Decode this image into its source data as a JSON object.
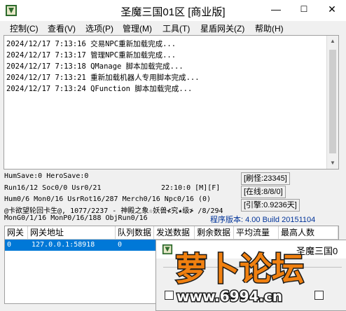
{
  "window": {
    "title": "圣魔三国01区 [商业版]",
    "minimize": "—",
    "maximize": "☐",
    "close": "✕"
  },
  "menu": [
    "控制(C)",
    "查看(V)",
    "选项(P)",
    "管理(M)",
    "工具(T)",
    "星盾网关(Z)",
    "帮助(H)"
  ],
  "log": [
    "2024/12/17 7:13:16 交易NPC重新加载完成...",
    "2024/12/17 7:13:17 管理NPC重新加载完成...",
    "2024/12/17 7:13:18 QManage 脚本加载完成...",
    "2024/12/17 7:13:21 重新加载机器人专用脚本完成...",
    "2024/12/17 7:13:24 QFunction 脚本加载完成..."
  ],
  "status": {
    "line1": "HumSave:0 HeroSave:0",
    "line2": "Run16/12 Soc0/0 Usr0/21",
    "time": "22:10:0 [M][F]",
    "line3": "Hum0/6 Mon0/16 UsrRot16/287 Merch0/16 Npc0/16 (0)",
    "line4": "@卡欲望轮回卡生@, 1077/2237 - 神殿之象☆妖兽≮究★级≯ /8/294",
    "line5": "MonG0/1/16 MonP0/16/188 ObjRun0/16",
    "refresh": "[刷怪:23345]",
    "online": "[在线:8/8/0]",
    "days": "[引擎:0.9236天]",
    "version": "程序版本: 4.00 Build 20151104"
  },
  "table": {
    "headers": [
      "网关",
      "网关地址",
      "队列数据",
      "发送数据",
      "剩余数据",
      "平均流量",
      "最高人数"
    ],
    "rows": [
      [
        "0",
        "127.0.0.1:58918",
        "0",
        "",
        "",
        "",
        ""
      ]
    ]
  },
  "child_window": {
    "title": "圣魔三国0"
  },
  "watermark": {
    "text": "萝卜论坛",
    "url": "www.6994.cn"
  },
  "colors": {
    "selection": "#0078d7",
    "version_text": "#003399",
    "watermark_orange": "#f08010"
  }
}
